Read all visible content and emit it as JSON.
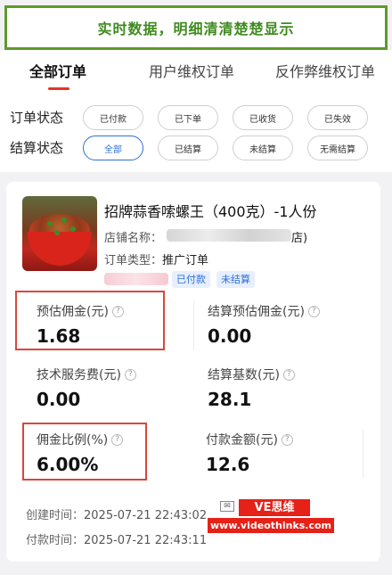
{
  "banner": {
    "text": "实时数据，明细清清楚楚显示"
  },
  "tabs": [
    {
      "label": "全部订单",
      "active": true
    },
    {
      "label": "用户维权订单",
      "active": false
    },
    {
      "label": "反作弊维权订单",
      "active": false
    }
  ],
  "filters": {
    "order_status": {
      "label": "订单状态",
      "options": [
        "已付款",
        "已下单",
        "已收货",
        "已失效"
      ]
    },
    "settle_status": {
      "label": "结算状态",
      "options": [
        "全部",
        "已结算",
        "未结算",
        "无需结算"
      ],
      "selected": "全部"
    }
  },
  "order": {
    "product_title": "招牌蒜香嗦螺王（400克）-1人份",
    "shop_label": "店铺名称：",
    "shop_value_visible": "店",
    "order_type_label": "订单类型：",
    "order_type_value": "推广订单",
    "tags": [
      "已付款",
      "未结算"
    ],
    "metrics": {
      "estimated_commission": {
        "label": "预估佣金(元)",
        "value": "1.68"
      },
      "settle_estimated_commission": {
        "label": "结算预估佣金(元)",
        "value": "0.00"
      },
      "tech_service_fee": {
        "label": "技术服务费(元)",
        "value": "0.00"
      },
      "settle_base": {
        "label": "结算基数(元)",
        "value": "28.1"
      },
      "commission_rate": {
        "label": "佣金比例(%)",
        "value": "6.00%"
      },
      "paid_amount": {
        "label": "付款金额(元)",
        "value": "12.6"
      }
    },
    "created_label": "创建时间：",
    "created_time": "2025-07-21 22:43:02",
    "paid_label": "付款时间：",
    "paid_time": "2025-07-21 22:43:11"
  },
  "watermark": {
    "brand": "VE思维",
    "url": "www.videothinks.com"
  },
  "icons": {
    "help": "question-circle-icon"
  },
  "colors": {
    "accent_blue": "#2e6fd8",
    "tab_red": "#e8332a",
    "highlight_red": "#d9473d",
    "banner_green": "#3f8a1f"
  }
}
